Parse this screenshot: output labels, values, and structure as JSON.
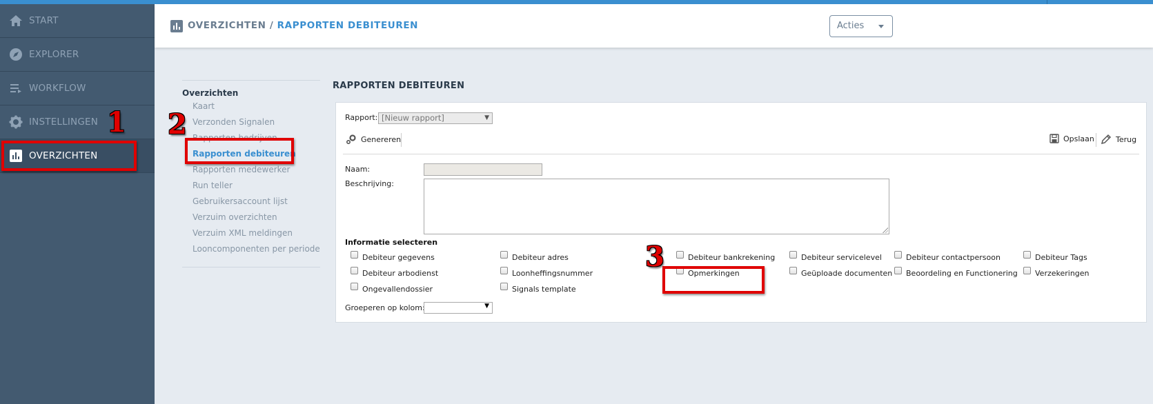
{
  "sidebar": {
    "items": [
      {
        "label": "START",
        "icon": "home-icon"
      },
      {
        "label": "EXPLORER",
        "icon": "compass-icon"
      },
      {
        "label": "WORKFLOW",
        "icon": "list-icon"
      },
      {
        "label": "INSTELLINGEN",
        "icon": "gear-icon"
      },
      {
        "label": "OVERZICHTEN",
        "icon": "chart-icon",
        "active": true
      }
    ]
  },
  "header": {
    "breadcrumb_parent": "OVERZICHTEN",
    "breadcrumb_sep": " / ",
    "breadcrumb_current": "RAPPORTEN DEBITEUREN",
    "actions_label": "Acties"
  },
  "submenu": {
    "title": "Overzichten",
    "items": [
      "Kaart",
      "Verzonden Signalen",
      "Rapporten bedrijven",
      "Rapporten debiteuren",
      "Rapporten medewerker",
      "Run teller",
      "Gebruikersaccount lijst",
      "Verzuim overzichten",
      "Verzuim XML meldingen",
      "Looncomponenten per periode"
    ],
    "active_index": 3
  },
  "main": {
    "heading": "RAPPORTEN DEBITEUREN",
    "rapport_label": "Rapport:",
    "rapport_value": "[Nieuw rapport]",
    "generate_label": "Genereren",
    "save_label": "Opslaan",
    "back_label": "Terug",
    "naam_label": "Naam:",
    "naam_value": "",
    "beschrijving_label": "Beschrijving:",
    "beschrijving_value": "",
    "info_title": "Informatie selecteren",
    "checkboxes": [
      "Debiteur gegevens",
      "Debiteur adres",
      "Debiteur bankrekening",
      "Debiteur servicelevel",
      "Debiteur contactpersoon",
      "Debiteur Tags",
      "Debiteur arbodienst",
      "Loonheffingsnummer",
      "Opmerkingen",
      "Geüploade documenten",
      "Beoordeling en Functionering",
      "Verzekeringen",
      "Ongevallendossier",
      "Signals template"
    ],
    "group_label": "Groeperen op kolom:",
    "group_value": ""
  },
  "annotations": {
    "step1": "1",
    "step2": "2",
    "step3": "3",
    "color": "#e00000"
  },
  "colors": {
    "accent": "#3a8fd0",
    "sidebar": "#435a70",
    "background": "#e6ebf1"
  }
}
